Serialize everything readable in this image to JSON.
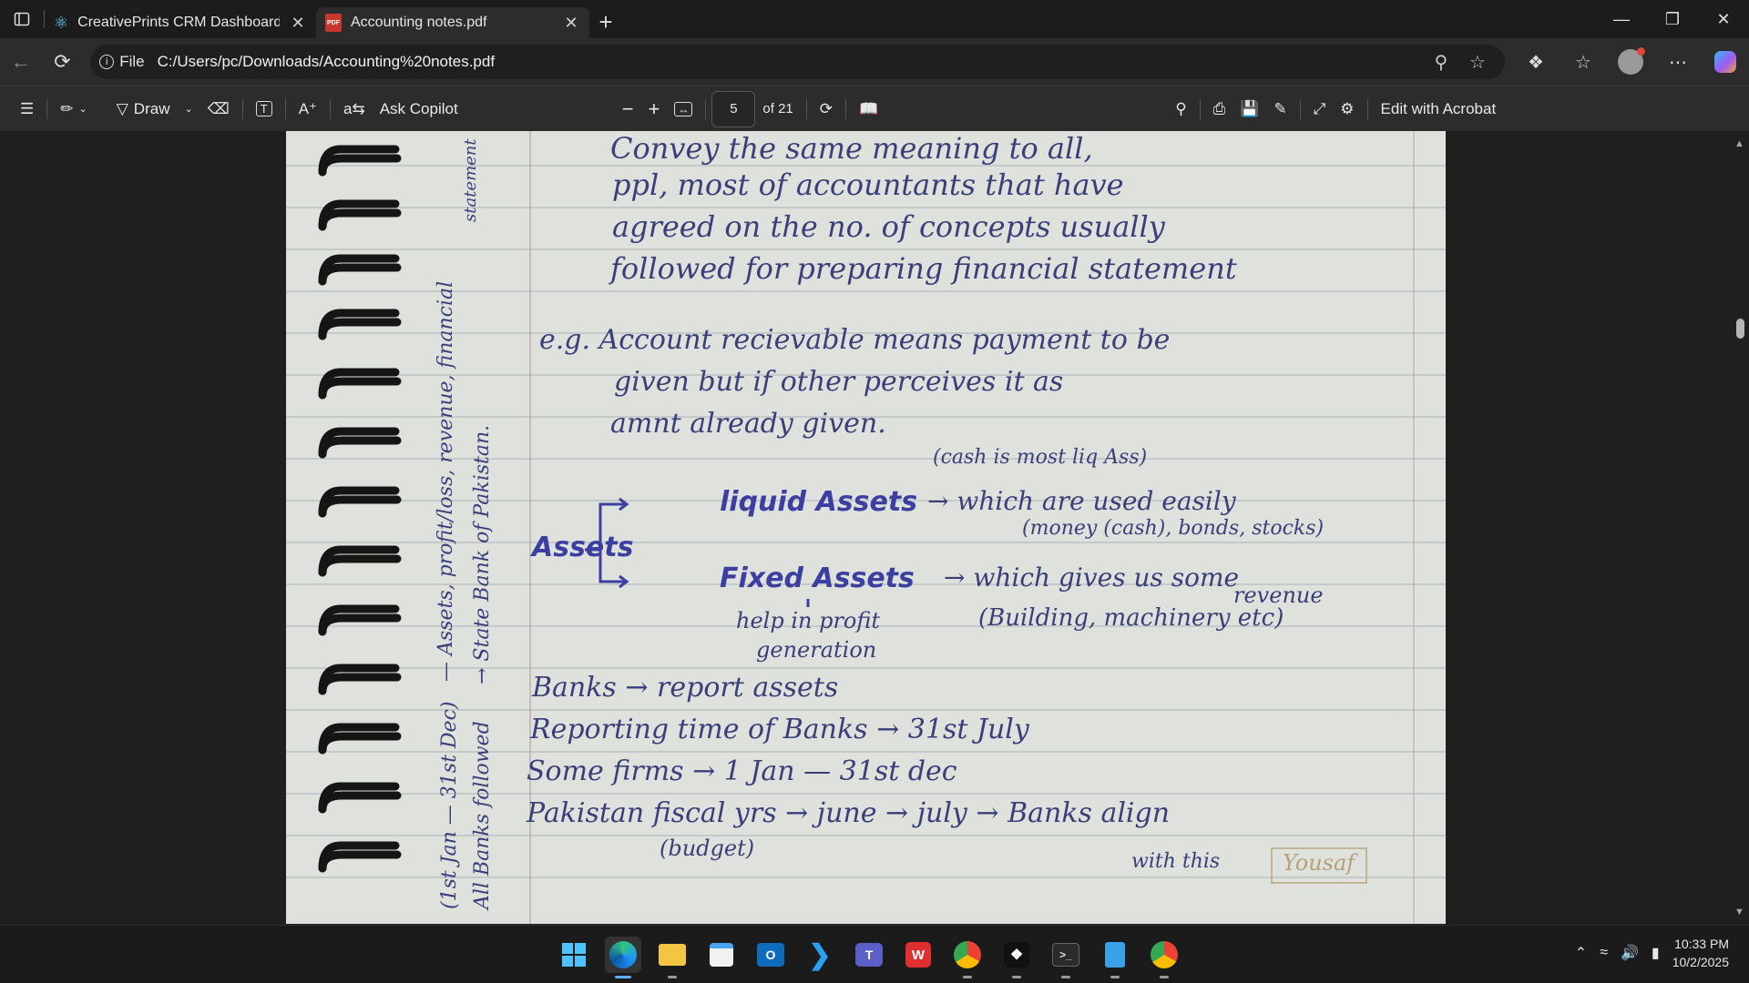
{
  "tabs": [
    {
      "title": "CreativePrints CRM Dashboard",
      "icon": "react-icon",
      "active": false
    },
    {
      "title": "Accounting notes.pdf",
      "icon": "pdf-icon",
      "active": true
    }
  ],
  "address": {
    "scheme_label": "File",
    "url": "C:/Users/pc/Downloads/Accounting%20notes.pdf"
  },
  "pdf_toolbar": {
    "draw_label": "Draw",
    "ask_copilot_label": "Ask Copilot",
    "current_page": "5",
    "page_total_label": "of 21",
    "edit_acrobat_label": "Edit with Acrobat"
  },
  "notes": {
    "line1": "Convey the same meaning to all,",
    "line2": "ppl, most of accountants that have",
    "line3": "agreed on the no. of concepts usually",
    "line4": "followed for preparing financial statement",
    "eg_line1": "e.g. Account recievable means payment to be",
    "eg_line2": "given but if other perceives it as",
    "eg_line3": "amnt already given.",
    "cash_note": "(cash is most liq Ass)",
    "assets_label": "Assets",
    "liquid_label": "liquid Assets",
    "liquid_desc": "→ which are used easily",
    "liquid_examples": "(money (cash), bonds, stocks)",
    "fixed_label": "Fixed Assets",
    "fixed_desc": "→ which gives us some",
    "fixed_desc2": "revenue",
    "fixed_examples": "(Building, machinery etc)",
    "help_note1": "help in profit",
    "help_note2": "generation",
    "banks_line": "Banks → report assets",
    "reporting_line": "Reporting time of Banks → 31st July",
    "firms_line": "Some firms → 1 Jan — 31st dec",
    "pakistan_line": "Pakistan fiscal yrs → june → july → Banks align",
    "budget_note": "(budget)",
    "with_this": "with this",
    "stamp": "Yousaf",
    "margin_note1": "— Assets, profit/loss, revenue, financial",
    "margin_note1b": "statement",
    "margin_note2": "→ State Bank of Pakistan.",
    "margin_note3": "(1st Jan — 31st Dec)",
    "margin_note4": "All Banks followed"
  },
  "taskbar": {
    "apps": [
      "windows-start",
      "edge",
      "file-explorer",
      "microsoft-store",
      "outlook",
      "vscode",
      "teams",
      "wps-office",
      "chrome",
      "app",
      "terminal",
      "notepad",
      "chrome-profile"
    ],
    "time": "10:33 PM",
    "date": "10/2/2025"
  }
}
